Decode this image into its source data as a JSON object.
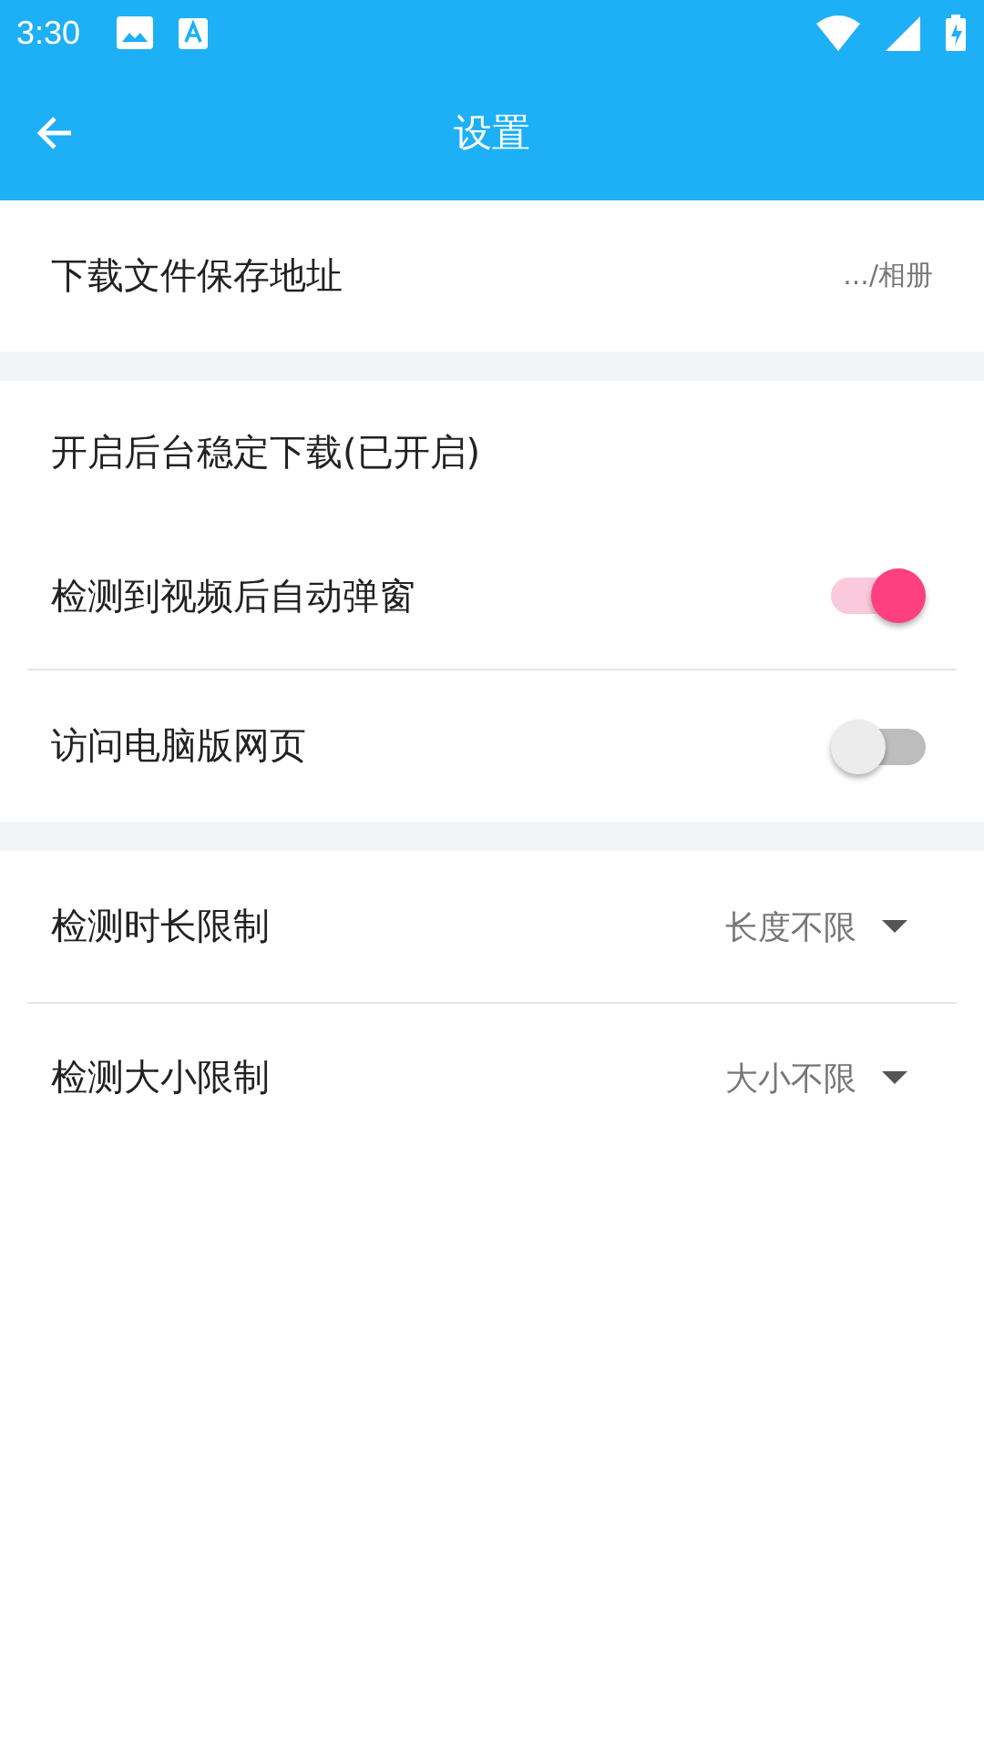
{
  "status_bar": {
    "time": "3:30"
  },
  "app_bar": {
    "title": "设置"
  },
  "sections": [
    {
      "items": [
        {
          "kind": "path",
          "label": "下载文件保存地址",
          "value": ".../相册"
        }
      ]
    },
    {
      "items": [
        {
          "kind": "plain",
          "label": "开启后台稳定下载(已开启)"
        },
        {
          "kind": "switch",
          "label": "检测到视频后自动弹窗",
          "on": true
        },
        {
          "kind": "switch",
          "label": "访问电脑版网页",
          "on": false
        }
      ]
    },
    {
      "items": [
        {
          "kind": "dropdown",
          "label": "检测时长限制",
          "value": "长度不限"
        },
        {
          "kind": "dropdown",
          "label": "检测大小限制",
          "value": "大小不限"
        }
      ]
    }
  ]
}
